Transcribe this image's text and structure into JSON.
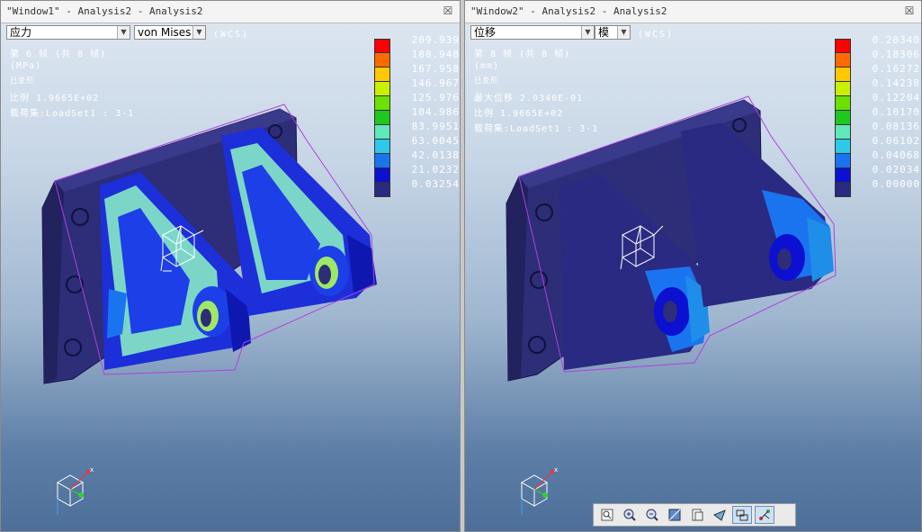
{
  "window1": {
    "title": "\"Window1\" - Analysis2 - Analysis2",
    "combo_type": "应力",
    "combo_component": "von Mises",
    "wcs": "(WCS)",
    "info": [
      "第 6 帧 (共 8 帧)",
      "(MPa)",
      "已变形",
      "比例   1.9665E+02",
      "载荷集:LoadSet1 :  3-1"
    ],
    "legend_values": [
      "209.939",
      "188.948",
      "167.958",
      "146.967",
      "125.976",
      "104.986",
      "83.9951",
      "63.0045",
      "42.0138",
      "21.0232",
      "0.03254"
    ]
  },
  "window2": {
    "title": "\"Window2\" - Analysis2 - Analysis2",
    "combo_type": "位移",
    "combo_component": "模",
    "wcs": "(WCS)",
    "info": [
      "第 8 帧 (共 8 帧)",
      "(mm)",
      "已变形",
      "最大位移   2.0340E-01",
      "比例   1.9665E+02",
      "载荷集:LoadSet1 :  3-1"
    ],
    "legend_values": [
      "0.20340",
      "0.18306",
      "0.16272",
      "0.14238",
      "0.12204",
      "0.10170",
      "0.08136",
      "0.06102",
      "0.04068",
      "0.02034",
      "0.00000"
    ]
  },
  "legend_colors": [
    "#ff0000",
    "#ff6a00",
    "#ffc800",
    "#c8f000",
    "#6ce000",
    "#1ec81e",
    "#60e8b8",
    "#2ec8e8",
    "#1a74f0",
    "#0c10d0",
    "#2a2a82"
  ],
  "triad_axes": {
    "x": "x",
    "y": "y",
    "z": "z"
  },
  "close_glyph": "☒",
  "toolbar": [
    "fit-icon",
    "zoom-in-icon",
    "zoom-out-icon",
    "shading-icon",
    "saved-views-icon",
    "orient-icon",
    "display-style-icon",
    "spin-center-icon"
  ]
}
